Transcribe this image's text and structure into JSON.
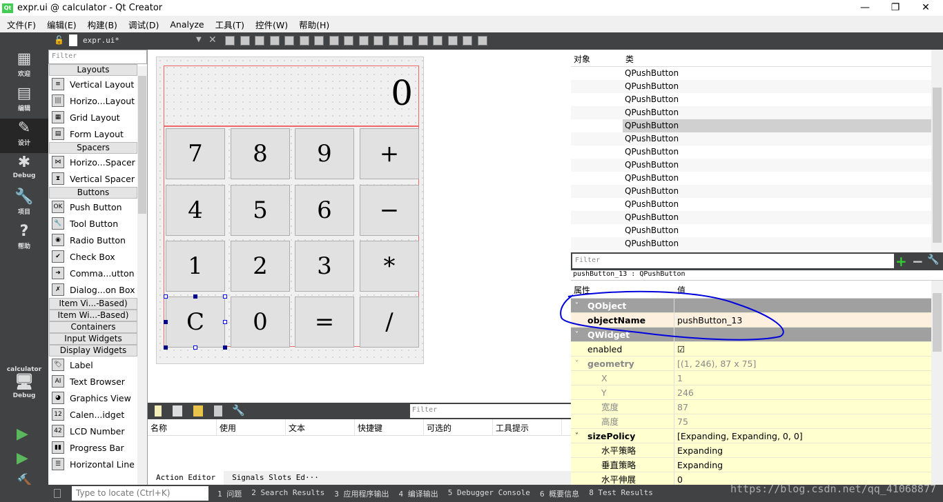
{
  "window": {
    "title": "expr.ui @ calculator - Qt Creator",
    "logo": "Qt",
    "min": "—",
    "max": "❐",
    "close": "✕"
  },
  "menu": [
    "文件(F)",
    "编辑(E)",
    "构建(B)",
    "调试(D)",
    "Analyze",
    "工具(T)",
    "控件(W)",
    "帮助(H)"
  ],
  "toolbar": {
    "file": "expr.ui*"
  },
  "modes": [
    {
      "label": "欢迎",
      "icon": "grid-icon",
      "glyph": "▦"
    },
    {
      "label": "编辑",
      "icon": "edit-icon",
      "glyph": "▤"
    },
    {
      "label": "设计",
      "icon": "pencil-icon",
      "glyph": "✎"
    },
    {
      "label": "Debug",
      "icon": "bug-icon",
      "glyph": "✱"
    },
    {
      "label": "项目",
      "icon": "wrench-icon",
      "glyph": "🔧"
    },
    {
      "label": "帮助",
      "icon": "help-icon",
      "glyph": "?"
    }
  ],
  "kit": {
    "project": "calculator",
    "mode": "Debug"
  },
  "widgetbox": {
    "filter_placeholder": "Filter",
    "items": [
      {
        "type": "cat",
        "label": "Layouts"
      },
      {
        "label": "Vertical Layout",
        "ic": "≡"
      },
      {
        "label": "Horizo...Layout",
        "ic": "|||"
      },
      {
        "label": "Grid Layout",
        "ic": "▦"
      },
      {
        "label": "Form Layout",
        "ic": "▤"
      },
      {
        "type": "cat",
        "label": "Spacers"
      },
      {
        "label": "Horizo...Spacer",
        "ic": "⋈"
      },
      {
        "label": "Vertical Spacer",
        "ic": "⧗"
      },
      {
        "type": "cat",
        "label": "Buttons"
      },
      {
        "label": "Push Button",
        "ic": "OK"
      },
      {
        "label": "Tool Button",
        "ic": "🔧"
      },
      {
        "label": "Radio Button",
        "ic": "◉"
      },
      {
        "label": "Check Box",
        "ic": "✔"
      },
      {
        "label": "Comma...utton",
        "ic": "➜"
      },
      {
        "label": "Dialog...on Box",
        "ic": "✗"
      },
      {
        "type": "cat",
        "label": "Item Vi...-Based)"
      },
      {
        "type": "cat",
        "label": "Item Wi...-Based)"
      },
      {
        "type": "cat",
        "label": "Containers"
      },
      {
        "type": "cat",
        "label": "Input Widgets"
      },
      {
        "type": "cat",
        "label": "Display Widgets"
      },
      {
        "label": "Label",
        "ic": "🏷"
      },
      {
        "label": "Text Browser",
        "ic": "AI"
      },
      {
        "label": "Graphics View",
        "ic": "◕"
      },
      {
        "label": "Calen...idget",
        "ic": "12"
      },
      {
        "label": "LCD Number",
        "ic": "42"
      },
      {
        "label": "Progress Bar",
        "ic": "▮▮"
      },
      {
        "label": "Horizontal Line",
        "ic": "☰"
      }
    ]
  },
  "form": {
    "display": "0",
    "buttons": [
      "7",
      "8",
      "9",
      "+",
      "4",
      "5",
      "6",
      "−",
      "1",
      "2",
      "3",
      "*",
      "C",
      "0",
      "=",
      "/"
    ]
  },
  "action_editor": {
    "filter_placeholder": "Filter",
    "columns": [
      "名称",
      "使用",
      "文本",
      "快捷键",
      "可选的",
      "工具提示"
    ],
    "tabs": [
      "Action Editor",
      "Signals  Slots Ed···"
    ]
  },
  "object_inspector": {
    "columns": [
      "对象",
      "类"
    ],
    "rows": [
      "QPushButton",
      "QPushButton",
      "QPushButton",
      "QPushButton",
      "QPushButton",
      "QPushButton",
      "QPushButton",
      "QPushButton",
      "QPushButton",
      "QPushButton",
      "QPushButton",
      "QPushButton",
      "QPushButton",
      "QPushButton"
    ],
    "selected_index": 4
  },
  "property_editor": {
    "filter_placeholder": "Filter",
    "class_label": "pushButton_13 : QPushButton",
    "columns": [
      "属性",
      "值"
    ],
    "rows": [
      {
        "k": "QObject",
        "v": "",
        "s": "grp",
        "arrow": "˅"
      },
      {
        "k": "objectName",
        "v": "pushButton_13",
        "s": "o bold"
      },
      {
        "k": "QWidget",
        "v": "",
        "s": "grp",
        "arrow": "˅"
      },
      {
        "k": "enabled",
        "v": "☑",
        "s": "y"
      },
      {
        "k": "geometry",
        "v": "[(1, 246), 87 x 75]",
        "s": "y dim bold",
        "arrow": "˅"
      },
      {
        "k": "X",
        "v": "1",
        "s": "y dim sub"
      },
      {
        "k": "Y",
        "v": "246",
        "s": "y dim sub"
      },
      {
        "k": "宽度",
        "v": "87",
        "s": "y dim sub"
      },
      {
        "k": "高度",
        "v": "75",
        "s": "y dim sub"
      },
      {
        "k": "sizePolicy",
        "v": "[Expanding, Expanding, 0, 0]",
        "s": "y bold",
        "arrow": "˅"
      },
      {
        "k": "水平策略",
        "v": "Expanding",
        "s": "y sub"
      },
      {
        "k": "垂直策略",
        "v": "Expanding",
        "s": "y sub"
      },
      {
        "k": "水平伸展",
        "v": "0",
        "s": "y sub"
      }
    ]
  },
  "statusbar": {
    "locate_placeholder": "Type to locate (Ctrl+K)",
    "tabs": [
      "1 问题",
      "2 Search Results",
      "3 应用程序输出",
      "4 编译输出",
      "5 Debugger Console",
      "6 概要信息",
      "8 Test Results"
    ]
  },
  "watermark": "https://blog.csdn.net/qq_41068877",
  "colors": {
    "dark": "#404244",
    "annotation": "#0000dd",
    "layout_border": "#ee6666",
    "selected_group": "#a0a0a0"
  }
}
